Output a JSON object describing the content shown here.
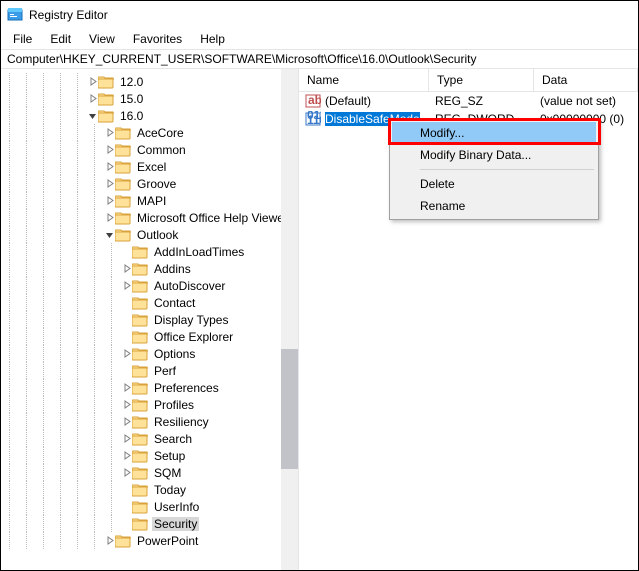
{
  "window": {
    "title": "Registry Editor"
  },
  "menu": {
    "file": "File",
    "edit": "Edit",
    "view": "View",
    "favorites": "Favorites",
    "help": "Help"
  },
  "path": "Computer\\HKEY_CURRENT_USER\\SOFTWARE\\Microsoft\\Office\\16.0\\Outlook\\Security",
  "tree": [
    {
      "indent": 5,
      "expand": "closed",
      "label": "12.0"
    },
    {
      "indent": 5,
      "expand": "closed",
      "label": "15.0"
    },
    {
      "indent": 5,
      "expand": "open",
      "label": "16.0"
    },
    {
      "indent": 6,
      "expand": "closed",
      "label": "AceCore"
    },
    {
      "indent": 6,
      "expand": "closed",
      "label": "Common"
    },
    {
      "indent": 6,
      "expand": "closed",
      "label": "Excel"
    },
    {
      "indent": 6,
      "expand": "closed",
      "label": "Groove"
    },
    {
      "indent": 6,
      "expand": "closed",
      "label": "MAPI"
    },
    {
      "indent": 6,
      "expand": "closed",
      "label": "Microsoft Office Help Viewer"
    },
    {
      "indent": 6,
      "expand": "open",
      "label": "Outlook"
    },
    {
      "indent": 7,
      "expand": "none",
      "label": "AddInLoadTimes"
    },
    {
      "indent": 7,
      "expand": "closed",
      "label": "Addins"
    },
    {
      "indent": 7,
      "expand": "closed",
      "label": "AutoDiscover"
    },
    {
      "indent": 7,
      "expand": "none",
      "label": "Contact"
    },
    {
      "indent": 7,
      "expand": "none",
      "label": "Display Types"
    },
    {
      "indent": 7,
      "expand": "none",
      "label": "Office Explorer"
    },
    {
      "indent": 7,
      "expand": "closed",
      "label": "Options"
    },
    {
      "indent": 7,
      "expand": "none",
      "label": "Perf"
    },
    {
      "indent": 7,
      "expand": "closed",
      "label": "Preferences"
    },
    {
      "indent": 7,
      "expand": "closed",
      "label": "Profiles"
    },
    {
      "indent": 7,
      "expand": "closed",
      "label": "Resiliency"
    },
    {
      "indent": 7,
      "expand": "closed",
      "label": "Search"
    },
    {
      "indent": 7,
      "expand": "closed",
      "label": "Setup"
    },
    {
      "indent": 7,
      "expand": "closed",
      "label": "SQM"
    },
    {
      "indent": 7,
      "expand": "none",
      "label": "Today"
    },
    {
      "indent": 7,
      "expand": "none",
      "label": "UserInfo"
    },
    {
      "indent": 7,
      "expand": "none",
      "label": "Security",
      "selected": true
    },
    {
      "indent": 6,
      "expand": "closed",
      "label": "PowerPoint"
    }
  ],
  "list": {
    "headers": {
      "name": "Name",
      "type": "Type",
      "data": "Data"
    },
    "rows": [
      {
        "icon": "sz",
        "name": "(Default)",
        "type": "REG_SZ",
        "data": "(value not set)"
      },
      {
        "icon": "dw",
        "name": "DisableSafeMode",
        "type": "REG_DWORD",
        "data": "0x00000000 (0)",
        "selected": true
      }
    ]
  },
  "ctx": {
    "modify": "Modify...",
    "modify_bin": "Modify Binary Data...",
    "delete": "Delete",
    "rename": "Rename"
  }
}
